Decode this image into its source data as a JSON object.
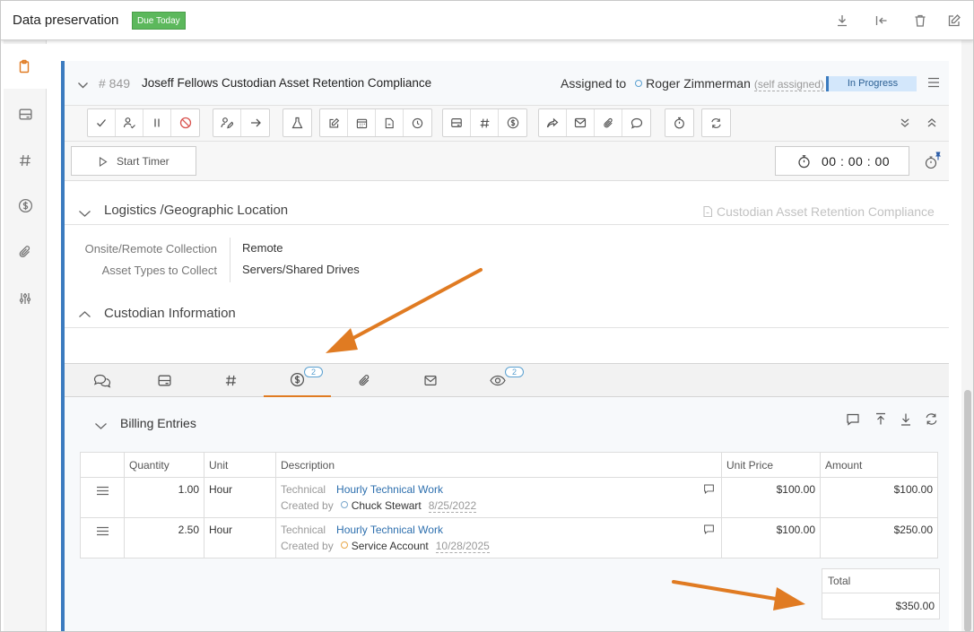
{
  "page": {
    "title": "Data preservation",
    "due_badge": "Due Today"
  },
  "header_icons": [
    "download-icon",
    "exit-icon",
    "trash-icon",
    "edit-icon"
  ],
  "sidebar": {
    "items": [
      "clipboard-icon",
      "card-icon",
      "hash-icon",
      "dollar-icon",
      "paperclip-icon",
      "sliders-icon"
    ]
  },
  "ticket": {
    "number": "# 849",
    "title": "Joseff Fellows Custodian Asset Retention Compliance",
    "assigned_label": "Assigned to",
    "assignee": "Roger Zimmerman",
    "self_assigned": "(self assigned)",
    "status": "In Progress"
  },
  "timer": {
    "start_label": "Start Timer",
    "value": "00 : 00 : 00"
  },
  "logistics": {
    "title": "Logistics /Geographic Location",
    "link": "Custodian Asset Retention Compliance",
    "fields": [
      {
        "label": "Onsite/Remote Collection",
        "value": "Remote"
      },
      {
        "label": "Asset Types to Collect",
        "value": "Servers/Shared Drives"
      }
    ]
  },
  "custodian": {
    "title": "Custodian Information"
  },
  "tabs": {
    "billing_count": "2",
    "watch_count": "2"
  },
  "billing": {
    "title": "Billing Entries",
    "columns": [
      "Quantity",
      "Unit",
      "Description",
      "Unit Price",
      "Amount"
    ],
    "rows": [
      {
        "quantity": "1.00",
        "unit": "Hour",
        "category": "Technical",
        "item": "Hourly Technical Work",
        "created_by_label": "Created by",
        "creator": "Chuck Stewart",
        "date": "8/25/2022",
        "unit_price": "$100.00",
        "amount": "$100.00"
      },
      {
        "quantity": "2.50",
        "unit": "Hour",
        "category": "Technical",
        "item": "Hourly Technical Work",
        "created_by_label": "Created by",
        "creator": "Service Account",
        "date": "10/28/2025",
        "unit_price": "$100.00",
        "amount": "$250.00"
      }
    ],
    "total_label": "Total",
    "total_value": "$350.00"
  },
  "colors": {
    "accent": "#e07b22",
    "primary": "#3b7bbf",
    "due_badge": "#5cb85c",
    "status_bg": "#d3e7fb"
  }
}
